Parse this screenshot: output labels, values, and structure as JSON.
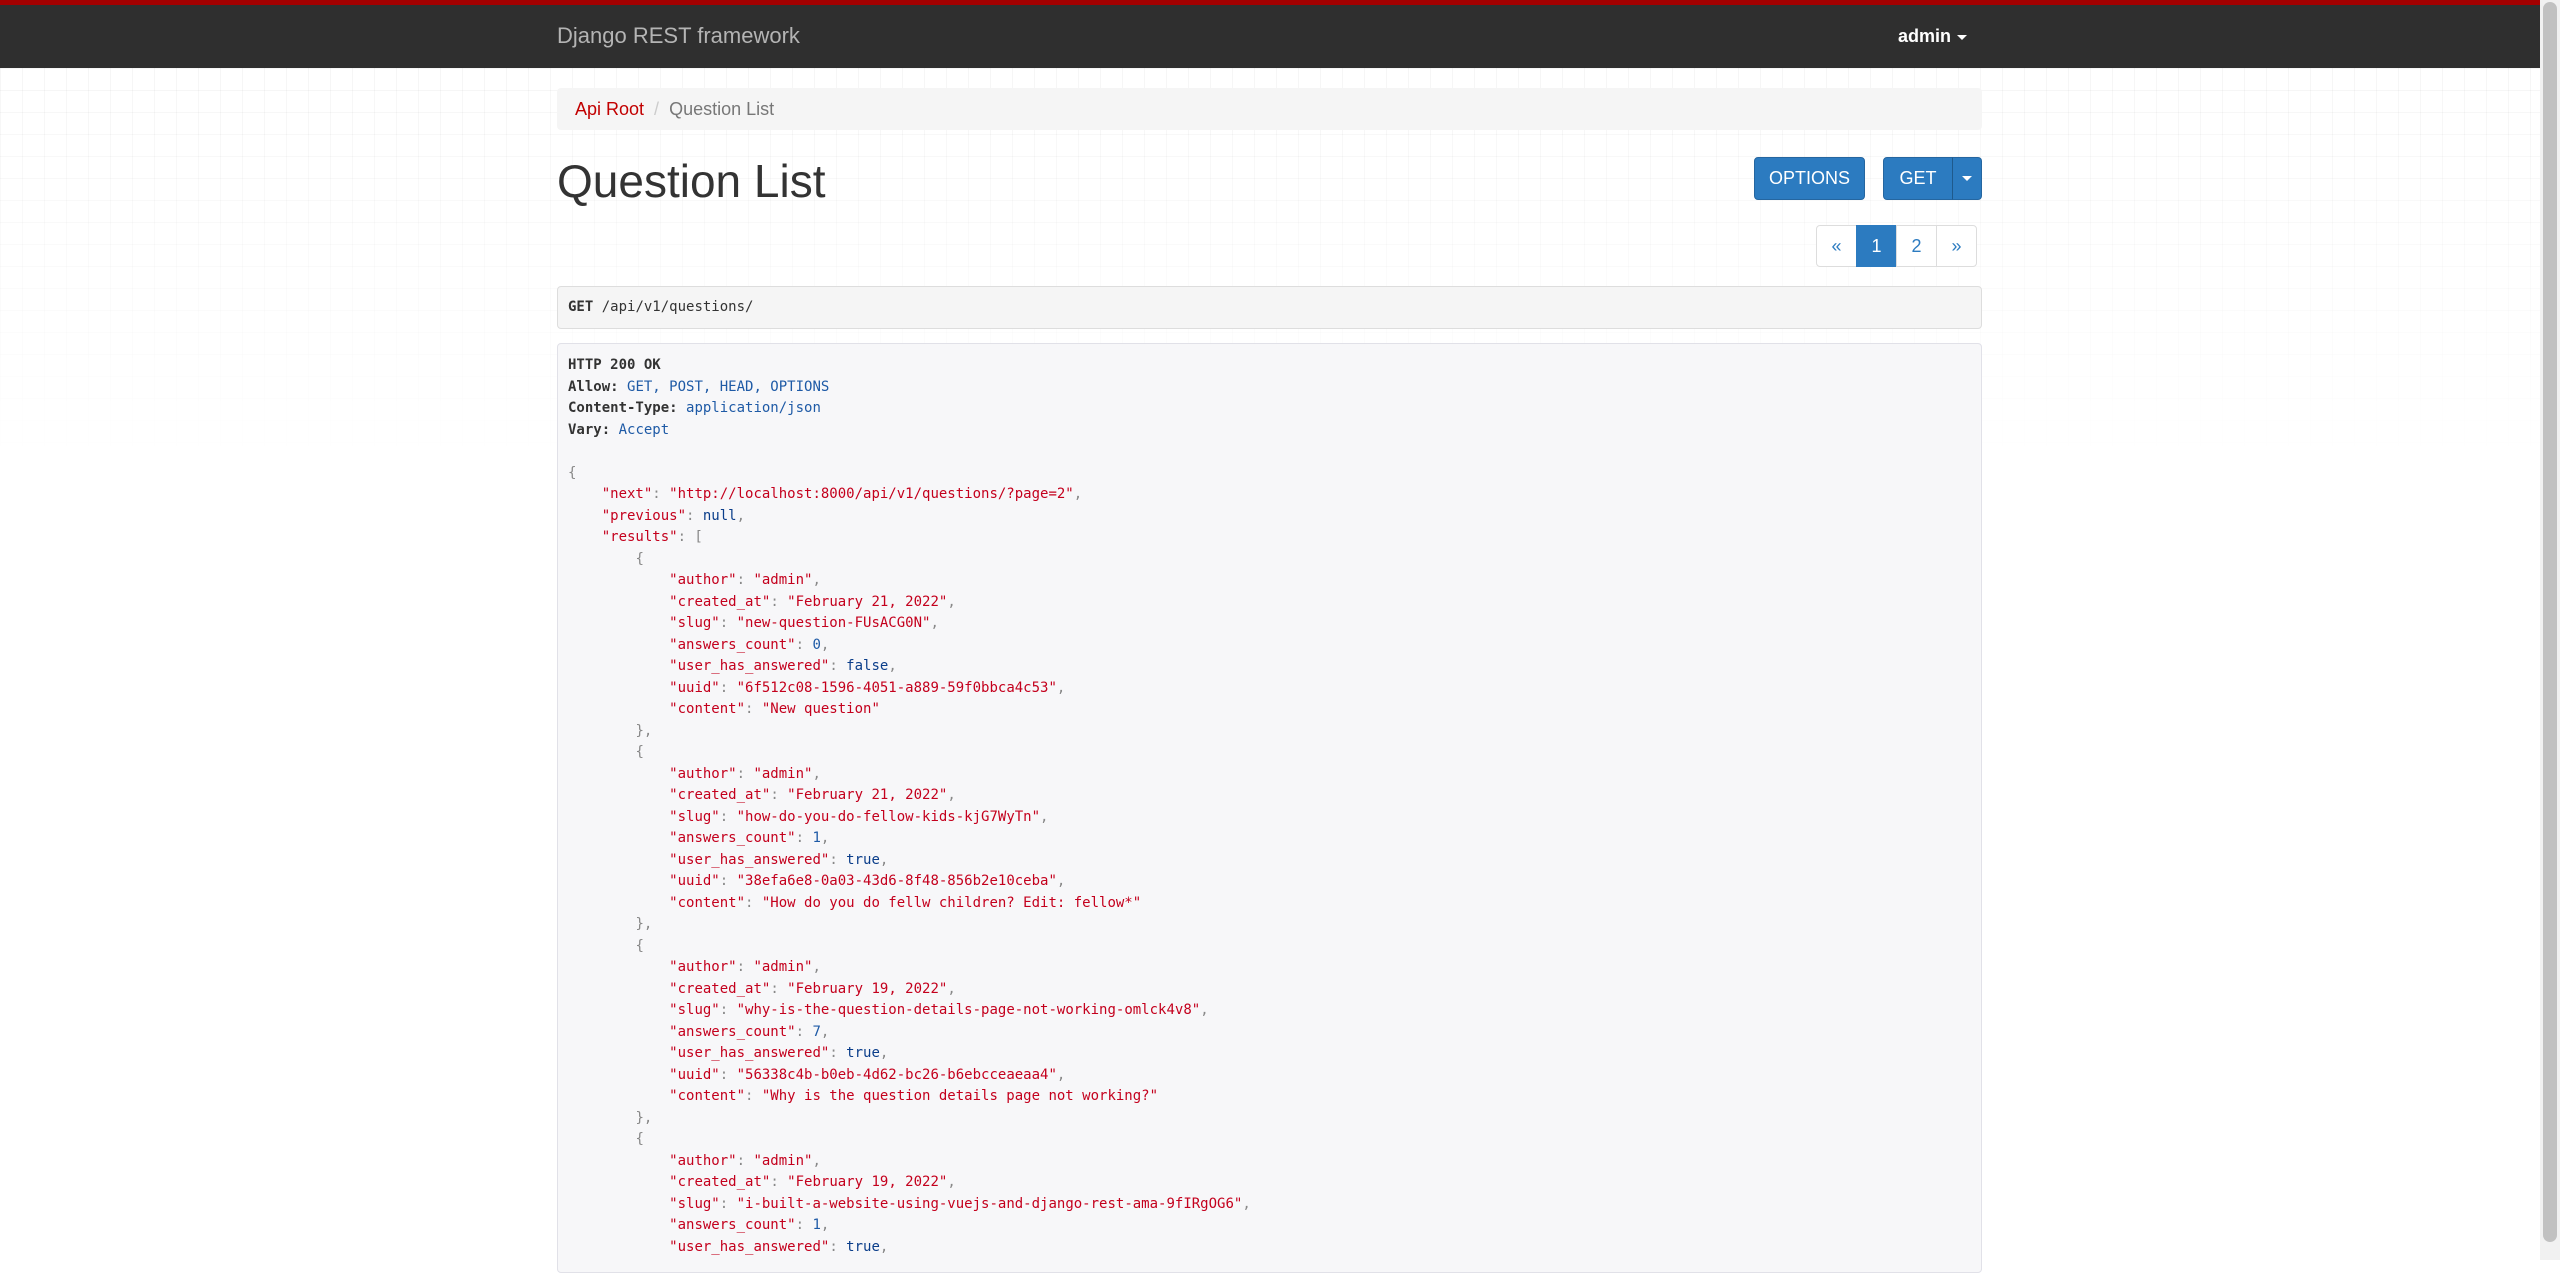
{
  "navbar": {
    "brand": "Django REST framework",
    "user": "admin",
    "accent_color": "#a30000",
    "background_color": "#2f2f2f"
  },
  "breadcrumb": {
    "root_label": "Api Root",
    "separator": "/",
    "current_label": "Question List"
  },
  "page": {
    "title": "Question List"
  },
  "actions": {
    "options_label": "OPTIONS",
    "get_label": "GET",
    "button_color": "#2c7bc0"
  },
  "pagination": {
    "prev": "«",
    "pages": [
      "1",
      "2"
    ],
    "active_page": "1",
    "next": "»"
  },
  "request": {
    "method": "GET",
    "path": "/api/v1/questions/"
  },
  "response": {
    "status": "HTTP 200 OK",
    "headers": [
      {
        "name": "Allow:",
        "value": "GET, POST, HEAD, OPTIONS"
      },
      {
        "name": "Content-Type:",
        "value": "application/json"
      },
      {
        "name": "Vary:",
        "value": "Accept"
      }
    ],
    "body": {
      "next": "\"http://localhost:8000/api/v1/questions/?page=2\"",
      "previous": "null",
      "results": [
        {
          "author": "\"admin\"",
          "created_at": "\"February 21, 2022\"",
          "slug": "\"new-question-FUsACG0N\"",
          "answers_count": "0",
          "user_has_answered": "false",
          "uuid": "\"6f512c08-1596-4051-a889-59f0bbca4c53\"",
          "content": "\"New question\""
        },
        {
          "author": "\"admin\"",
          "created_at": "\"February 21, 2022\"",
          "slug": "\"how-do-you-do-fellow-kids-kjG7WyTn\"",
          "answers_count": "1",
          "user_has_answered": "true",
          "uuid": "\"38efa6e8-0a03-43d6-8f48-856b2e10ceba\"",
          "content": "\"How do you do fellw children? Edit: fellow*\""
        },
        {
          "author": "\"admin\"",
          "created_at": "\"February 19, 2022\"",
          "slug": "\"why-is-the-question-details-page-not-working-omlck4v8\"",
          "answers_count": "7",
          "user_has_answered": "true",
          "uuid": "\"56338c4b-b0eb-4d62-bc26-b6ebcceaeaa4\"",
          "content": "\"Why is the question details page not working?\""
        },
        {
          "author": "\"admin\"",
          "created_at": "\"February 19, 2022\"",
          "slug": "\"i-built-a-website-using-vuejs-and-django-rest-ama-9fIRgOG6\"",
          "answers_count": "1",
          "user_has_answered": "true"
        }
      ]
    }
  }
}
